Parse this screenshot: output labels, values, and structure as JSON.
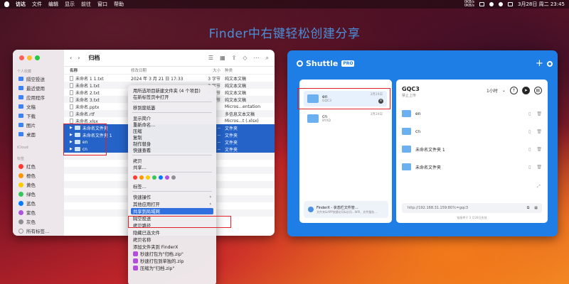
{
  "menubar": {
    "items": [
      "访达",
      "文件",
      "编辑",
      "显示",
      "前往",
      "窗口",
      "帮助"
    ],
    "net_up": "0KB/s",
    "net_down": "0KB/s",
    "clock": "3月28日 周二 23:45"
  },
  "headline": "Finder中右键轻松创建分享",
  "finder": {
    "title": "归档",
    "sidebar": {
      "section_personal": "个人收藏",
      "items": [
        "隔空投送",
        "最近使用",
        "应用程序",
        "文稿",
        "下载",
        "图片",
        "桌面"
      ],
      "section_icloud": "iCloud",
      "section_tags": "标签",
      "tags": [
        {
          "label": "红色",
          "color": "#ff3b30"
        },
        {
          "label": "橙色",
          "color": "#ff9500"
        },
        {
          "label": "黄色",
          "color": "#ffcc00"
        },
        {
          "label": "绿色",
          "color": "#34c759"
        },
        {
          "label": "蓝色",
          "color": "#007aff"
        },
        {
          "label": "紫色",
          "color": "#af52de"
        },
        {
          "label": "灰色",
          "color": "#8e8e93"
        },
        {
          "label": "所有标签…",
          "color": ""
        }
      ]
    },
    "columns": {
      "name": "名称",
      "date": "修改日期",
      "size": "大小",
      "kind": "种类"
    },
    "rows": [
      {
        "name": "未命名 1 1.txt",
        "date": "2024 年 3 月 21 日 17:33",
        "size": "3 字节",
        "kind": "纯文本文稿"
      },
      {
        "name": "未命名 1.txt",
        "date": "",
        "size": "3 字节",
        "kind": "纯文本文稿"
      },
      {
        "name": "未命名 2.txt",
        "date": "",
        "size": "3 字节",
        "kind": "纯文本文稿"
      },
      {
        "name": "未命名 3.txt",
        "date": "",
        "size": "3 字节",
        "kind": "纯文本文稿"
      },
      {
        "name": "未命名.pptx",
        "date": "",
        "size": "",
        "kind": "Micros...entation"
      },
      {
        "name": "未命名.rtf",
        "date": "",
        "size": "",
        "kind": "多信息文本文稿"
      },
      {
        "name": "未命名.xlsx",
        "date": "",
        "size": "",
        "kind": "Micros...t (.xlsx)"
      },
      {
        "name": "未命名文件夹",
        "date": "",
        "size": "--",
        "kind": "文件夹"
      },
      {
        "name": "未命名文件夹 1",
        "date": "",
        "size": "--",
        "kind": "文件夹"
      },
      {
        "name": "en",
        "date": "",
        "size": "--",
        "kind": "文件夹"
      },
      {
        "name": "cn",
        "date": "",
        "size": "--",
        "kind": "文件夹"
      }
    ]
  },
  "context_menu": {
    "items": [
      {
        "label": "用所选项目新建文件夹 (4 个项目)",
        "arrow": ""
      },
      {
        "label": "在新标签页中打开",
        "arrow": ""
      },
      {
        "label": "移到废纸篓",
        "arrow": ""
      },
      {
        "label": "显示简介",
        "arrow": ""
      },
      {
        "label": "重新命名…",
        "arrow": ""
      },
      {
        "label": "压缩",
        "arrow": ""
      },
      {
        "label": "复制",
        "arrow": ""
      },
      {
        "label": "制作替身",
        "arrow": ""
      },
      {
        "label": "快速查看",
        "arrow": ""
      },
      {
        "label": "拷贝",
        "arrow": ""
      },
      {
        "label": "共享…",
        "arrow": ""
      },
      {
        "label": "标签…",
        "arrow": ""
      },
      {
        "label": "快速操作",
        "arrow": "›"
      },
      {
        "label": "其他应用打开",
        "arrow": "›"
      },
      {
        "label": "共享到局域网",
        "arrow": ""
      },
      {
        "label": "隔空投送",
        "arrow": ""
      },
      {
        "label": "拷贝路径",
        "arrow": ""
      },
      {
        "label": "隐藏已选文件",
        "arrow": ""
      },
      {
        "label": "拷贝名称",
        "arrow": ""
      },
      {
        "label": "添加文件夹到 FinderX",
        "arrow": ""
      },
      {
        "label": "秒速打包为\"归档.zip\"",
        "arrow": ""
      },
      {
        "label": "秒速打包到单独的.zip",
        "arrow": ""
      },
      {
        "label": "压缩为\"归档.zip\"",
        "arrow": ""
      }
    ],
    "color_tags": [
      "#ff3b30",
      "#ff9500",
      "#ffcc00",
      "#34c759",
      "#007aff",
      "#af52de",
      "#8e8e93"
    ]
  },
  "shuttle": {
    "brand": "Shuttle",
    "pro": "PRO",
    "devices": [
      {
        "name": "en",
        "sub": "GQC3",
        "time": "3月29日"
      },
      {
        "name": "cn",
        "sub": "BYXD",
        "time": "3月29日"
      }
    ],
    "promo_title": "FinderX - 状态栏文件管…",
    "promo_sub": "文件夹&APP快捷访问&访问...Wifi、文件服务…",
    "panel_title": "GQC3",
    "panel_status": "禁止上传",
    "timer": "1小时",
    "items": [
      "en",
      "cn",
      "未命名文件夹 1",
      "未命名文件夹"
    ],
    "url": "http://192.168.31.159:80?c=gqc3",
    "url_sub": "链接将于 3 月28日失效"
  }
}
